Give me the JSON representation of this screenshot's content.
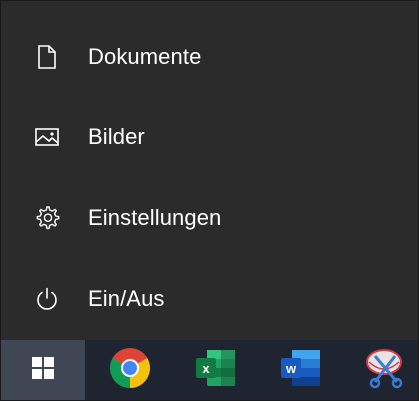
{
  "start_menu": {
    "items": [
      {
        "label": "Dokumente",
        "icon": "document-icon"
      },
      {
        "label": "Bilder",
        "icon": "pictures-icon"
      },
      {
        "label": "Einstellungen",
        "icon": "gear-icon"
      },
      {
        "label": "Ein/Aus",
        "icon": "power-icon"
      }
    ]
  },
  "taskbar": {
    "apps": [
      {
        "icon": "windows-start-icon"
      },
      {
        "icon": "chrome-icon"
      },
      {
        "icon": "excel-icon"
      },
      {
        "icon": "word-icon"
      },
      {
        "icon": "snipping-tool-icon"
      }
    ]
  },
  "colors": {
    "menu_bg": "#2b2b2b",
    "taskbar_bg": "#1f2530",
    "start_button_bg": "#3f4654",
    "text": "#ffffff"
  }
}
